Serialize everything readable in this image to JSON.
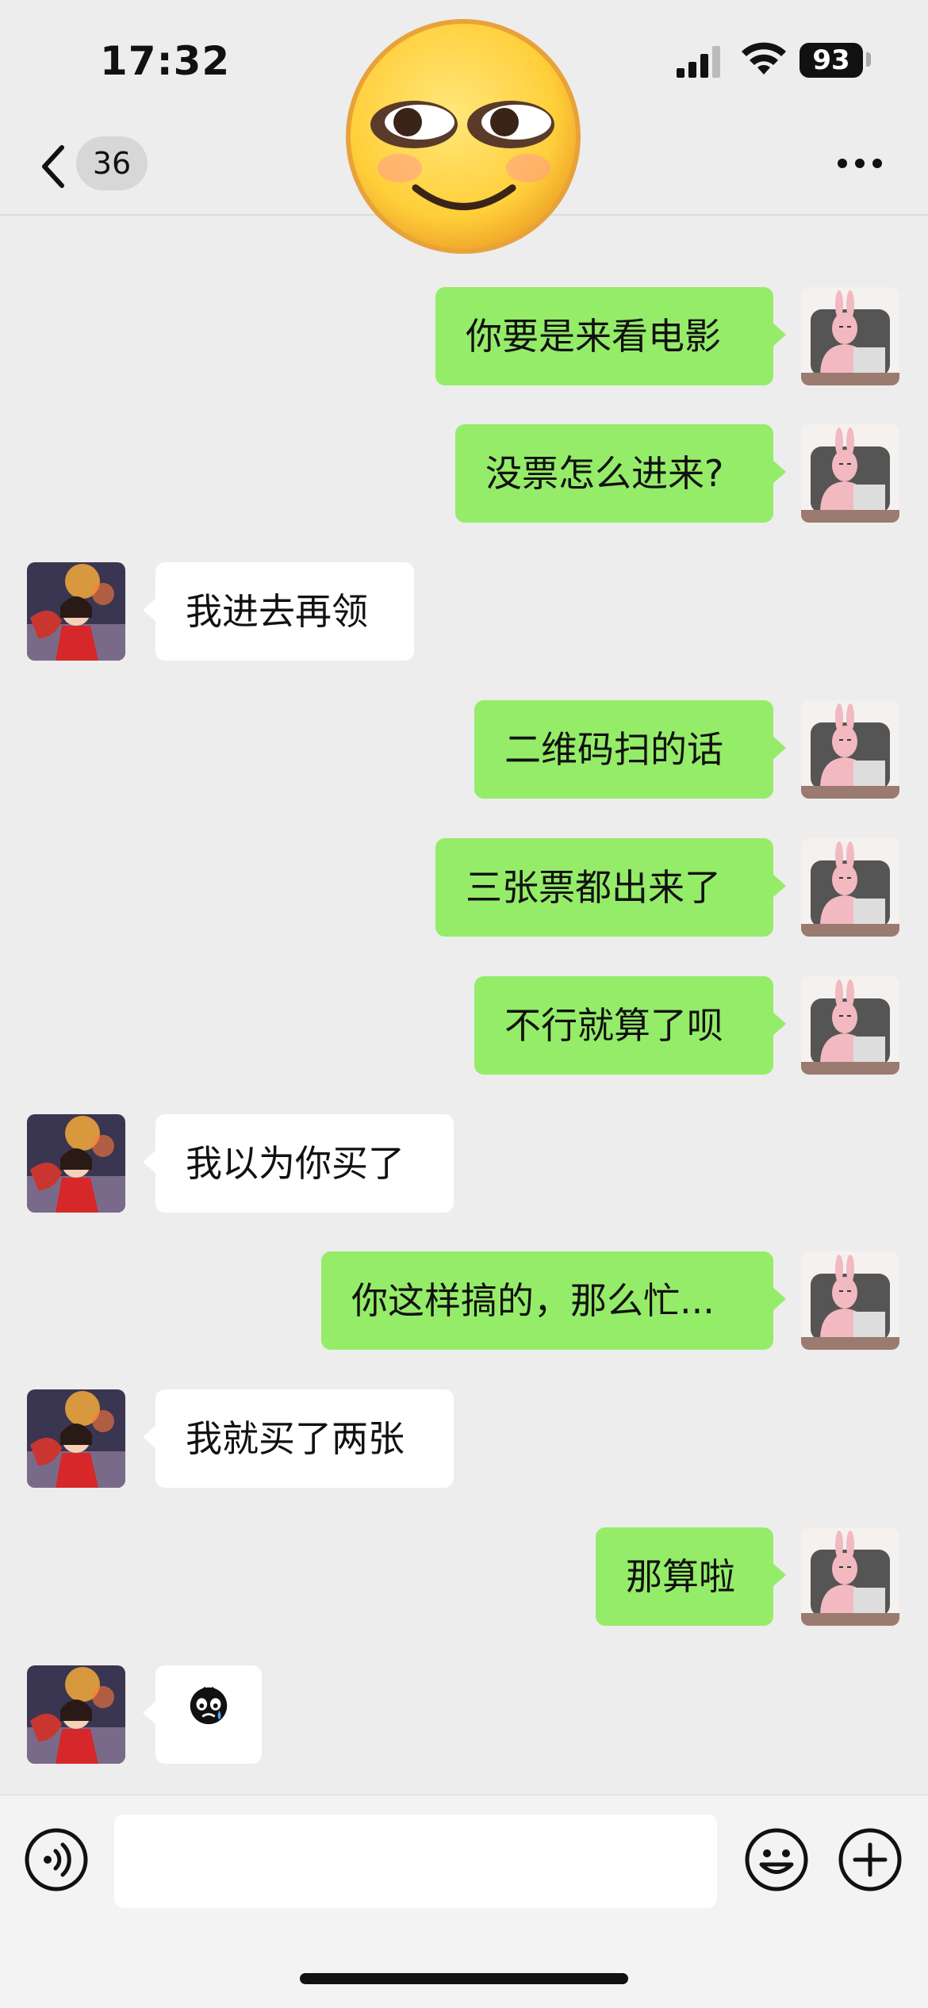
{
  "status": {
    "time": "17:32",
    "battery": "93"
  },
  "nav": {
    "unread_count": "36"
  },
  "messages": [
    {
      "from": "me",
      "text": "你要是来看电影"
    },
    {
      "from": "me",
      "text": "没票怎么进来?"
    },
    {
      "from": "them",
      "text": "我进去再领"
    },
    {
      "from": "me",
      "text": "二维码扫的话"
    },
    {
      "from": "me",
      "text": "三张票都出来了"
    },
    {
      "from": "me",
      "text": "不行就算了呗"
    },
    {
      "from": "them",
      "text": "我以为你买了"
    },
    {
      "from": "me",
      "text": "你这样搞的，那么忙..."
    },
    {
      "from": "them",
      "text": "我就买了两张"
    },
    {
      "from": "me",
      "text": "那算啦"
    },
    {
      "from": "them",
      "text": "",
      "sticker": "crying-face-sticker"
    }
  ],
  "colors": {
    "background": "#ededed",
    "my_bubble": "#95ec69",
    "their_bubble": "#ffffff"
  },
  "icons": [
    "back-arrow-icon",
    "more-dots-icon",
    "voice-icon",
    "emoji-icon",
    "plus-icon",
    "signal-icon",
    "wifi-icon"
  ]
}
